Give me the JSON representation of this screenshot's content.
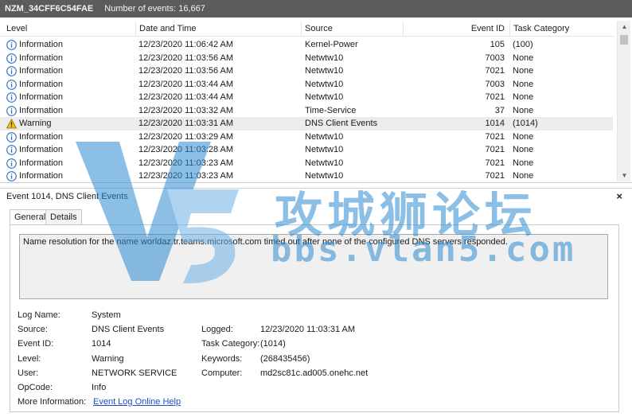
{
  "title_bar": {
    "log_name": "NZM_34CFF6C54FAE",
    "event_count": "Number of events: 16,667"
  },
  "grid": {
    "columns": {
      "level": "Level",
      "date": "Date and Time",
      "source": "Source",
      "event_id": "Event ID",
      "category": "Task Category"
    },
    "rows": [
      {
        "level": "Information",
        "date": "12/23/2020 11:06:42 AM",
        "source": "Kernel-Power",
        "event_id": "105",
        "category": "(100)",
        "icon": "info-icon"
      },
      {
        "level": "Information",
        "date": "12/23/2020 11:03:56 AM",
        "source": "Netwtw10",
        "event_id": "7003",
        "category": "None",
        "icon": "info-icon"
      },
      {
        "level": "Information",
        "date": "12/23/2020 11:03:56 AM",
        "source": "Netwtw10",
        "event_id": "7021",
        "category": "None",
        "icon": "info-icon"
      },
      {
        "level": "Information",
        "date": "12/23/2020 11:03:44 AM",
        "source": "Netwtw10",
        "event_id": "7003",
        "category": "None",
        "icon": "info-icon"
      },
      {
        "level": "Information",
        "date": "12/23/2020 11:03:44 AM",
        "source": "Netwtw10",
        "event_id": "7021",
        "category": "None",
        "icon": "info-icon"
      },
      {
        "level": "Information",
        "date": "12/23/2020 11:03:32 AM",
        "source": "Time-Service",
        "event_id": "37",
        "category": "None",
        "icon": "info-icon"
      },
      {
        "level": "Warning",
        "date": "12/23/2020 11:03:31 AM",
        "source": "DNS Client Events",
        "event_id": "1014",
        "category": "(1014)",
        "icon": "warning-icon",
        "selected": true
      },
      {
        "level": "Information",
        "date": "12/23/2020 11:03:29 AM",
        "source": "Netwtw10",
        "event_id": "7021",
        "category": "None",
        "icon": "info-icon"
      },
      {
        "level": "Information",
        "date": "12/23/2020 11:03:28 AM",
        "source": "Netwtw10",
        "event_id": "7021",
        "category": "None",
        "icon": "info-icon"
      },
      {
        "level": "Information",
        "date": "12/23/2020 11:03:23 AM",
        "source": "Netwtw10",
        "event_id": "7021",
        "category": "None",
        "icon": "info-icon"
      },
      {
        "level": "Information",
        "date": "12/23/2020 11:03:23 AM",
        "source": "Netwtw10",
        "event_id": "7021",
        "category": "None",
        "icon": "info-icon"
      }
    ]
  },
  "detail": {
    "header": "Event 1014, DNS Client Events",
    "close": "×",
    "tabs": [
      "General",
      "Details"
    ],
    "description": "Name resolution for the name worldaz.tr.teams.microsoft.com timed out after none of the configured DNS servers responded.",
    "labels": {
      "log_name": "Log Name:",
      "source": "Source:",
      "event_id": "Event ID:",
      "level": "Level:",
      "user": "User:",
      "opcode": "OpCode:",
      "more_info": "More Information:",
      "logged": "Logged:",
      "task_category": "Task Category:",
      "keywords": "Keywords:",
      "computer": "Computer:"
    },
    "values": {
      "log_name": "System",
      "source": "DNS Client Events",
      "event_id": "1014",
      "level": "Warning",
      "user": "NETWORK SERVICE",
      "opcode": "Info",
      "more_info": "Event Log Online Help",
      "logged": "12/23/2020 11:03:31 AM",
      "task_category": "(1014)",
      "keywords": "(268435456)",
      "computer": "md2sc81c.ad005.onehc.net"
    }
  },
  "watermark": {
    "chinese": "攻城狮论坛",
    "url": "bbs.vlan5.com"
  },
  "colors": {
    "title_bar": "#5c5c5c",
    "selected_row": "#ececec",
    "info_blue": "#2f6fc0",
    "warning_yellow": "#f2c21a",
    "link": "#1a4fc4",
    "watermark": "#2f8bd0"
  }
}
